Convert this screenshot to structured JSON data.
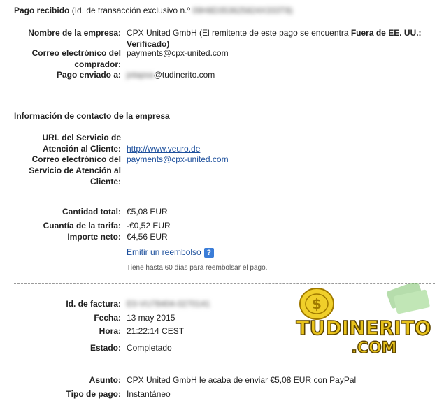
{
  "header": {
    "title": "Pago recibido",
    "txn_prefix": "(Id. de transacción exclusivo n.º",
    "txn_id": "09H8D353625824X333T8)"
  },
  "business": {
    "name_label": "Nombre de la empresa:",
    "name_value_1": "CPX United GmbH (El remitente de este pago se encuentra ",
    "name_value_bold": "Fuera de EE. UU.:",
    "name_value_2": "Verificado)",
    "buyer_email_label_1": "Correo electrónico del",
    "buyer_email_label_2": "comprador:",
    "buyer_email": "payments@cpx-united.com",
    "sent_to_label": "Pago enviado a:",
    "sent_to_blur": "jotapsa",
    "sent_to_domain": "@tudinerito.com"
  },
  "contact": {
    "title": "Información de contacto de la empresa",
    "url_label_1": "URL del Servicio de",
    "url_label_2": "Atención al Cliente:",
    "url_value": "http://www.veuro.de",
    "email_label_1": "Correo electrónico del",
    "email_label_2": "Servicio de Atención al",
    "email_label_3": "Cliente:",
    "email_value": "payments@cpx-united.com"
  },
  "amounts": {
    "total_label": "Cantidad total:",
    "total_value": "€5,08 EUR",
    "fee_label": "Cuantía de la tarifa:",
    "fee_value": "-€0,52 EUR",
    "net_label": "Importe neto:",
    "net_value": "€4,56 EUR",
    "refund_link": "Emitir un reembolso",
    "help_glyph": "?",
    "refund_note": "Tiene hasta 60 días para reembolsar el pago."
  },
  "invoice": {
    "id_label": "Id. de factura:",
    "id_value": "E0-VU78404-0270141",
    "date_label": "Fecha:",
    "date_value": "13 may 2015",
    "time_label": "Hora:",
    "time_value": "21:22:14 CEST",
    "status_label": "Estado:",
    "status_value": "Completado"
  },
  "subject": {
    "subject_label": "Asunto:",
    "subject_value": "CPX United GmbH le acaba de enviar €5,08 EUR con PayPal",
    "type_label": "Tipo de pago:",
    "type_value": "Instantáneo"
  },
  "watermark": {
    "line1": "TUDINERITO",
    "line2": ".COM",
    "coin_symbol": "$"
  },
  "colors": {
    "link": "#1c4f9c",
    "separator": "#9a9a9a",
    "help_icon": "#3b7dd8",
    "watermark_fill": "#e8c21a",
    "watermark_stroke": "#7a5a00"
  }
}
